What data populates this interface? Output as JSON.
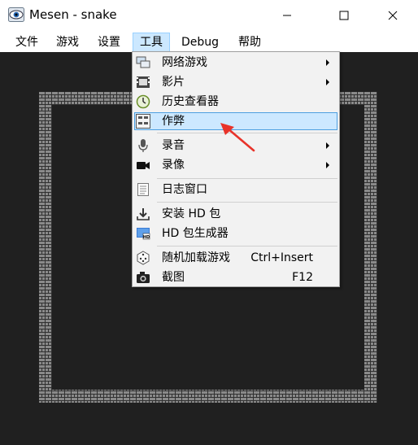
{
  "window": {
    "title": "Mesen - snake"
  },
  "menubar": {
    "items": [
      {
        "label": "文件"
      },
      {
        "label": "游戏"
      },
      {
        "label": "设置"
      },
      {
        "label": "工具"
      },
      {
        "label": "Debug"
      },
      {
        "label": "帮助"
      }
    ]
  },
  "tools_menu": {
    "items": [
      {
        "label": "网络游戏",
        "icon": "network-icon",
        "submenu": true
      },
      {
        "label": "影片",
        "icon": "film-icon",
        "submenu": true
      },
      {
        "label": "历史查看器",
        "icon": "history-icon"
      },
      {
        "label": "作弊",
        "icon": "cheat-icon",
        "selected": true
      },
      {
        "label": "录音",
        "icon": "microphone-icon",
        "submenu": true
      },
      {
        "label": "录像",
        "icon": "video-camera-icon",
        "submenu": true
      },
      {
        "label": "日志窗口",
        "icon": "log-icon"
      },
      {
        "label": "安装 HD 包",
        "icon": "download-icon"
      },
      {
        "label": "HD 包生成器",
        "icon": "hd-icon"
      },
      {
        "label": "随机加载游戏",
        "icon": "dice-icon",
        "shortcut": "Ctrl+Insert"
      },
      {
        "label": "截图",
        "icon": "camera-icon",
        "shortcut": "F12"
      }
    ]
  },
  "colors": {
    "selection_bg": "#cce8ff",
    "selection_border": "#4d9fe0",
    "game_bg": "#202020",
    "annotation_arrow": "#e8332a"
  }
}
